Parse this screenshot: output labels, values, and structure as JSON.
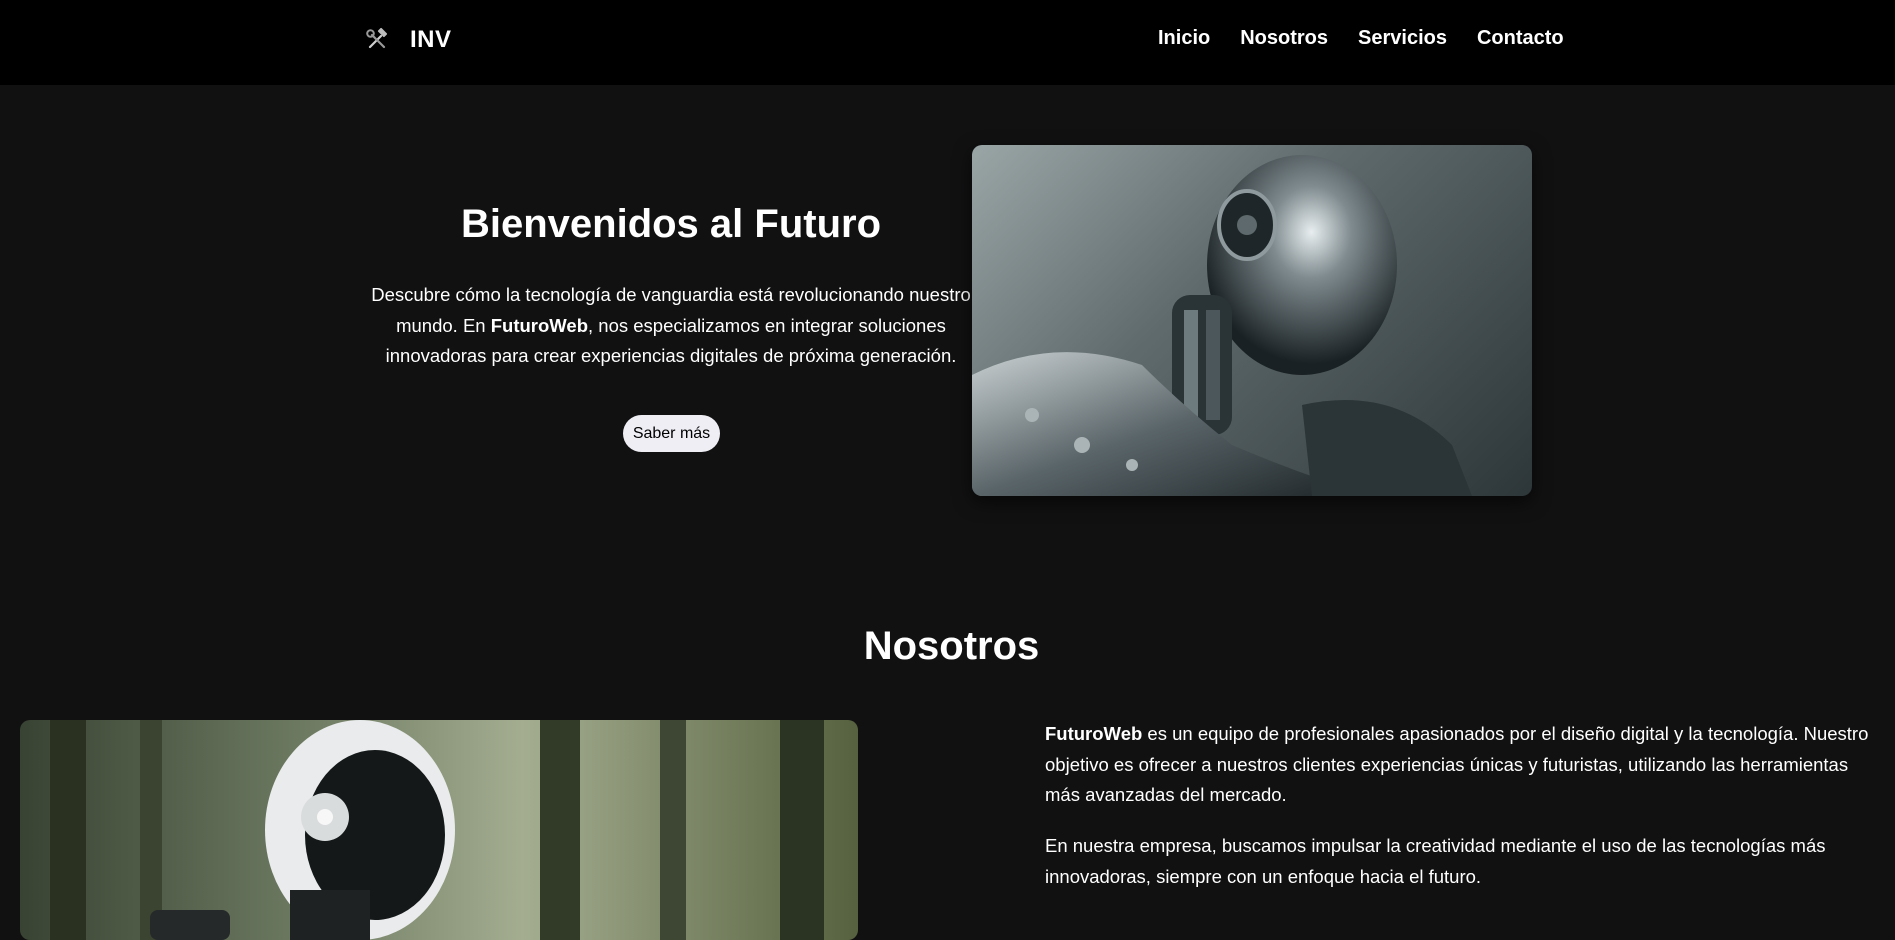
{
  "nav": {
    "brand_icon": "tools-icon",
    "brand_text": "INV",
    "links": [
      {
        "label": "Inicio"
      },
      {
        "label": "Nosotros"
      },
      {
        "label": "Servicios"
      },
      {
        "label": "Contacto"
      }
    ]
  },
  "hero": {
    "title": "Bienvenidos al Futuro",
    "text_before": "Descubre cómo la tecnología de vanguardia está revolucionando nuestro mundo. En ",
    "text_brand": "FuturoWeb",
    "text_after": ", nos especializamos en integrar soluciones innovadoras para crear experiencias digitales de próxima generación.",
    "button_label": "Saber más",
    "image": "robot-portrait-image"
  },
  "about": {
    "title": "Nosotros",
    "image": "robot-forest-image",
    "p1_brand": "FuturoWeb",
    "p1_text": " es un equipo de profesionales apasionados por el diseño digital y la tecnología. Nuestro objetivo es ofrecer a nuestros clientes experiencias únicas y futuristas, utilizando las herramientas más avanzadas del mercado.",
    "p2_text": "En nuestra empresa, buscamos impulsar la creatividad mediante el uso de las tecnologías más innovadoras, siempre con un enfoque hacia el futuro."
  },
  "colors": {
    "nav_bg": "#000000",
    "page_bg": "#111111",
    "text": "#ffffff",
    "button_bg": "#efeef5"
  }
}
